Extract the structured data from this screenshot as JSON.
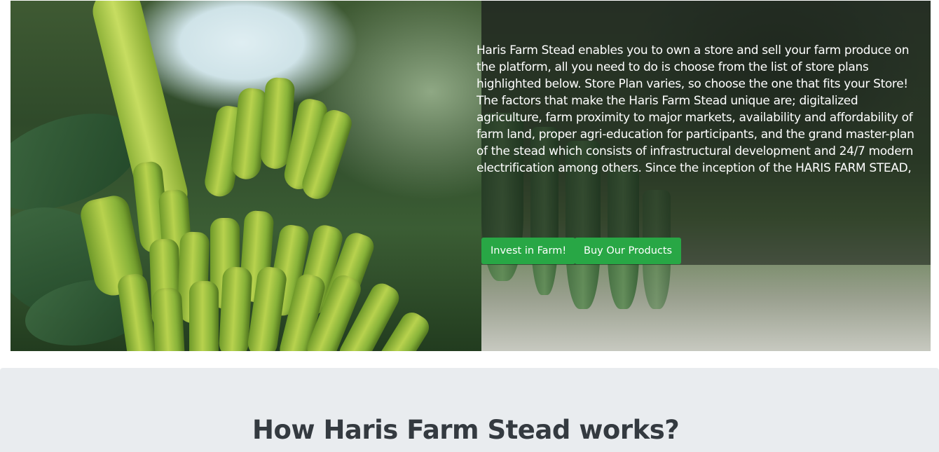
{
  "hero": {
    "image_subject": "banana bunch",
    "description": "Haris Farm Stead enables you to own a store and sell your farm produce on the platform, all you need to do is choose from the list of store plans highlighted below. Store Plan varies, so choose the one that fits your Store! The factors that make the Haris Farm Stead unique are; digitalized agriculture, farm proximity to major markets, availability and affordability of farm land, proper agri-education for participants, and the grand master-plan of the stead which consists of infrastructural development and 24/7 modern electrification among others. Since the inception of the HARIS FARM STEAD,",
    "invest_button": "Invest in Farm!",
    "buy_button": "Buy Our Products"
  },
  "works_section": {
    "title": "How Haris Farm Stead works?"
  },
  "colors": {
    "button_green": "#28a745",
    "section_bg": "#e9ecef",
    "heading": "#343a40"
  }
}
